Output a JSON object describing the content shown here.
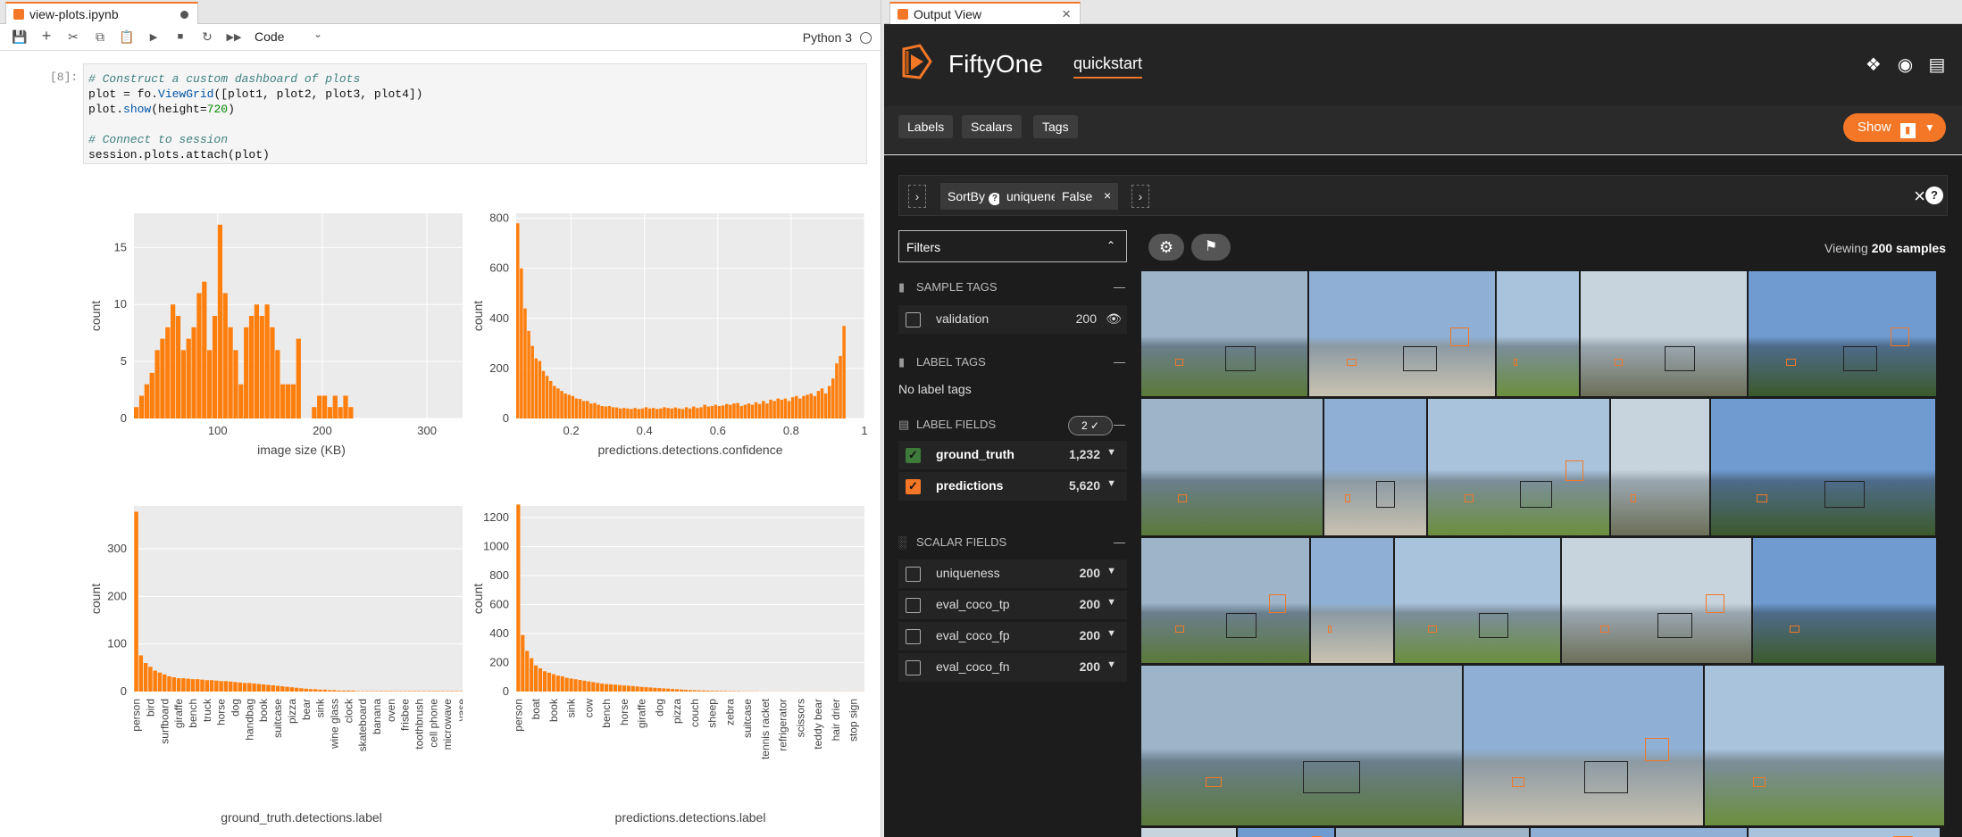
{
  "left_tab": {
    "title": "view-plots.ipynb"
  },
  "toolbar": {
    "cell_type": "Code",
    "kernel": "Python 3"
  },
  "cell": {
    "prompt": "[8]:",
    "lines": [
      {
        "c": "# Construct a custom dashboard of plots"
      },
      {
        "p": "plot = fo.",
        "f": "ViewGrid",
        "s": "([plot1, plot2, plot3, plot4])"
      },
      {
        "p": "plot.",
        "f": "show",
        "s": "(height=",
        "n": "720",
        "e": ")"
      },
      {
        "p": ""
      },
      {
        "c": "# Connect to session"
      },
      {
        "p": "session.plots.attach(plot)"
      }
    ]
  },
  "plots": [
    {
      "chart_data": {
        "type": "bar",
        "title": "",
        "xlabel": "image size (KB)",
        "ylabel": "count",
        "xlim": [
          20,
          340
        ],
        "ylim": [
          0,
          18
        ],
        "yticks": [
          0,
          5,
          10,
          15
        ],
        "xticks": [
          100,
          200,
          300
        ],
        "bin_start": 20,
        "bin_width": 5,
        "values": [
          1,
          2,
          3,
          4,
          6,
          7,
          8,
          10,
          9,
          6,
          7,
          8,
          11,
          12,
          6,
          9,
          17,
          11,
          8,
          6,
          3,
          8,
          9,
          10,
          9,
          10,
          8,
          6,
          3,
          3,
          3,
          7,
          0,
          0,
          1,
          2,
          2,
          1,
          2,
          1,
          2,
          1,
          0,
          0,
          0,
          0,
          0,
          0,
          0,
          0,
          0,
          0,
          0,
          0,
          0,
          0,
          0,
          0,
          0,
          0,
          0,
          0,
          0,
          0,
          1
        ]
      }
    },
    {
      "chart_data": {
        "type": "bar",
        "title": "",
        "xlabel": "predictions.detections.confidence",
        "ylabel": "count",
        "xlim": [
          0.05,
          1.0
        ],
        "ylim": [
          0,
          820
        ],
        "yticks": [
          0,
          200,
          400,
          600,
          800
        ],
        "xticks": [
          "0.2",
          "0.4",
          "0.6",
          "0.8",
          "1"
        ],
        "xtick_values": [
          0.2,
          0.4,
          0.6,
          0.8,
          1.0
        ],
        "bin_start": 0.05,
        "bin_width": 0.01,
        "values": [
          780,
          600,
          440,
          350,
          290,
          240,
          230,
          190,
          170,
          150,
          130,
          120,
          110,
          100,
          95,
          90,
          80,
          78,
          70,
          70,
          60,
          62,
          55,
          50,
          48,
          50,
          45,
          44,
          40,
          42,
          40,
          38,
          42,
          38,
          40,
          45,
          40,
          42,
          38,
          40,
          45,
          42,
          40,
          44,
          40,
          38,
          45,
          40,
          48,
          42,
          45,
          55,
          48,
          50,
          55,
          50,
          52,
          58,
          55,
          60,
          62,
          50,
          55,
          60,
          55,
          65,
          58,
          70,
          60,
          75,
          70,
          80,
          75,
          80,
          70,
          85,
          90,
          80,
          90,
          95,
          100,
          90,
          110,
          120,
          100,
          130,
          160,
          220,
          250,
          370
        ]
      }
    },
    {
      "chart_data": {
        "type": "bar",
        "title": "",
        "xlabel": "ground_truth.detections.label",
        "ylabel": "count",
        "ylim": [
          0,
          390
        ],
        "yticks": [
          0,
          100,
          200,
          300
        ],
        "categories": [
          "person",
          "bird",
          "surfboard",
          "giraffe",
          "bench",
          "truck",
          "horse",
          "dog",
          "handbag",
          "book",
          "suitcase",
          "pizza",
          "bear",
          "sink",
          "wine glass",
          "clock",
          "skateboard",
          "banana",
          "oven",
          "frisbee",
          "toothbrush",
          "cell phone",
          "microwave",
          "vase"
        ],
        "values": [
          378,
          76,
          60,
          52,
          44,
          40,
          36,
          32,
          30,
          28,
          28,
          27,
          26,
          26,
          25,
          24,
          24,
          23,
          22,
          22,
          21,
          20,
          19,
          18,
          18,
          17,
          16,
          15,
          14,
          13,
          12,
          11,
          10,
          9,
          8,
          7,
          6,
          5,
          5,
          4,
          4,
          3,
          3,
          2,
          2,
          2,
          2,
          1,
          1,
          1,
          1,
          1,
          1,
          1,
          1,
          1,
          1,
          1,
          1,
          1,
          1,
          1,
          1,
          1,
          1,
          1,
          1,
          1,
          1,
          1,
          1
        ],
        "tick_every": 3
      }
    },
    {
      "chart_data": {
        "type": "bar",
        "title": "",
        "xlabel": "predictions.detections.label",
        "ylabel": "count",
        "ylim": [
          0,
          1280
        ],
        "yticks": [
          0,
          200,
          400,
          600,
          800,
          1000,
          1200
        ],
        "categories": [
          "person",
          "boat",
          "book",
          "sink",
          "cow",
          "bench",
          "horse",
          "giraffe",
          "dog",
          "pizza",
          "couch",
          "sheep",
          "zebra",
          "suitcase",
          "tennis racket",
          "refrigerator",
          "scissors",
          "teddy bear",
          "hair drier",
          "stop sign"
        ],
        "values": [
          1290,
          390,
          280,
          230,
          180,
          160,
          140,
          130,
          120,
          110,
          105,
          95,
          90,
          85,
          80,
          75,
          70,
          65,
          60,
          55,
          52,
          50,
          48,
          45,
          42,
          40,
          38,
          35,
          32,
          30,
          28,
          26,
          24,
          22,
          20,
          18,
          16,
          14,
          12,
          10,
          9,
          8,
          7,
          6,
          5,
          5,
          4,
          4,
          3,
          3,
          3,
          2,
          2,
          2,
          2,
          1,
          1,
          1,
          1,
          1,
          1,
          1,
          1,
          1,
          1,
          1,
          1,
          1,
          1,
          1,
          1,
          1,
          1,
          1,
          1,
          1,
          1,
          1,
          1
        ],
        "tick_every": 4
      }
    }
  ],
  "right_tab": {
    "title": "Output View"
  },
  "app": {
    "brand": "FiftyOne",
    "dataset": "quickstart",
    "nav": [
      "Labels",
      "Scalars",
      "Tags"
    ],
    "show_label": "Show",
    "view_bar": {
      "stages": [
        "SortBy",
        "uniqueness",
        "False"
      ]
    },
    "filters_label": "Filters",
    "viewing_prefix": "Viewing ",
    "viewing_count": "200 samples",
    "sections": {
      "sample_tags": "SAMPLE TAGS",
      "label_tags": "LABEL TAGS",
      "label_fields": "LABEL FIELDS",
      "scalar_fields": "SCALAR FIELDS"
    },
    "sample_tags": [
      {
        "label": "validation",
        "count": "200"
      }
    ],
    "no_label_tags": "No label tags",
    "label_fields_badge": "2 ✓",
    "label_fields": [
      {
        "label": "ground_truth",
        "count": "1,232",
        "color": "#3e7b3a"
      },
      {
        "label": "predictions",
        "count": "5,620",
        "color": "#f37726"
      }
    ],
    "scalar_fields": [
      {
        "label": "uniqueness",
        "count": "200"
      },
      {
        "label": "eval_coco_tp",
        "count": "200"
      },
      {
        "label": "eval_coco_fp",
        "count": "200"
      },
      {
        "label": "eval_coco_fn",
        "count": "200"
      }
    ]
  },
  "colors": {
    "accent": "#f37726",
    "bar": "#ff7f0e",
    "plot_bg": "#ebebeb",
    "dark_bg": "#1c1c1c"
  }
}
